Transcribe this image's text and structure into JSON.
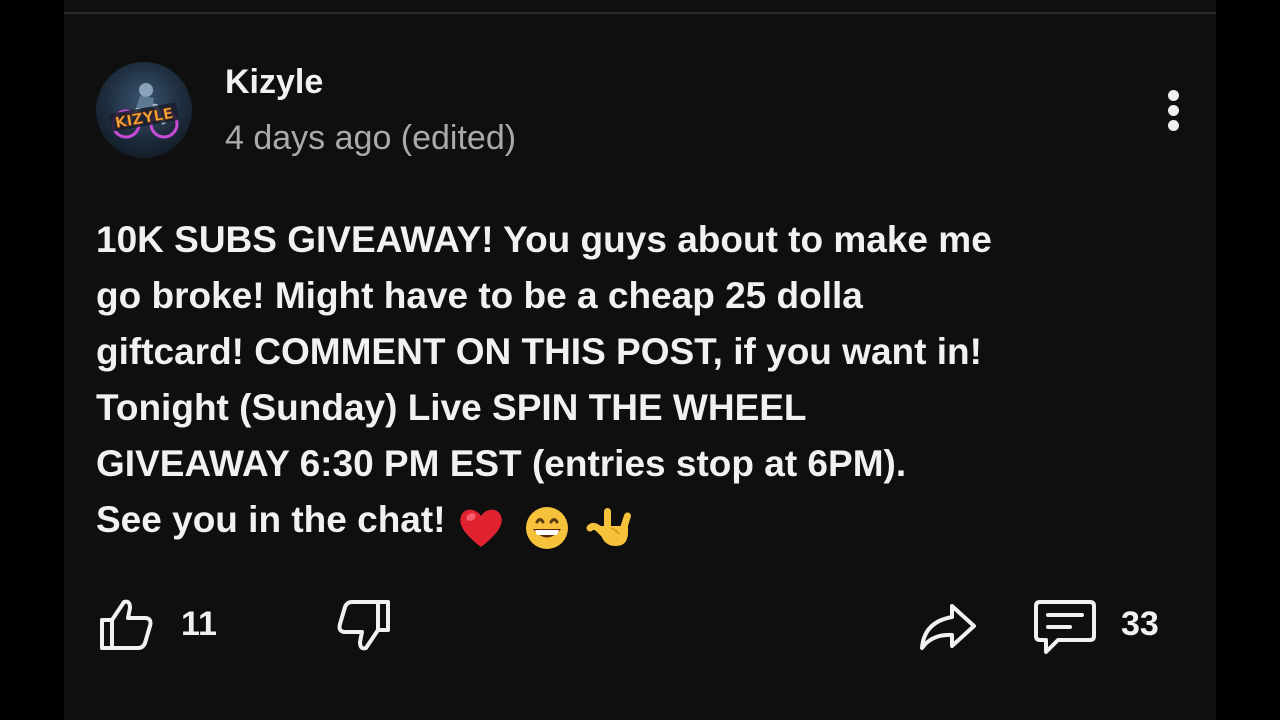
{
  "post": {
    "author": "Kizyle",
    "timestamp": "4 days ago (edited)",
    "lines": [
      "10K SUBS GIVEAWAY! You guys about to make me",
      "go broke! Might have to be a cheap 25 dolla",
      "giftcard! COMMENT ON THIS POST, if you want in!",
      "Tonight (Sunday) Live SPIN THE WHEEL",
      "GIVEAWAY 6:30 PM EST (entries stop at 6PM).",
      "See you in the chat!"
    ],
    "emojis": [
      "red-heart",
      "grinning-face",
      "love-you-gesture"
    ]
  },
  "avatar": {
    "logo_text": "KIZYLE"
  },
  "actions": {
    "like_count": "11",
    "comment_count": "33"
  },
  "icons": {
    "like": "thumbs-up-icon",
    "dislike": "thumbs-down-icon",
    "share": "share-icon",
    "comment": "comment-icon",
    "more": "more-vertical-icon"
  },
  "colors": {
    "background": "#000000",
    "card": "#0f0f0f",
    "primary_text": "#f1f1f1",
    "secondary_text": "#aaaaaa",
    "heart": "#e0212f",
    "emoji_yellow": "#f7c23b"
  }
}
